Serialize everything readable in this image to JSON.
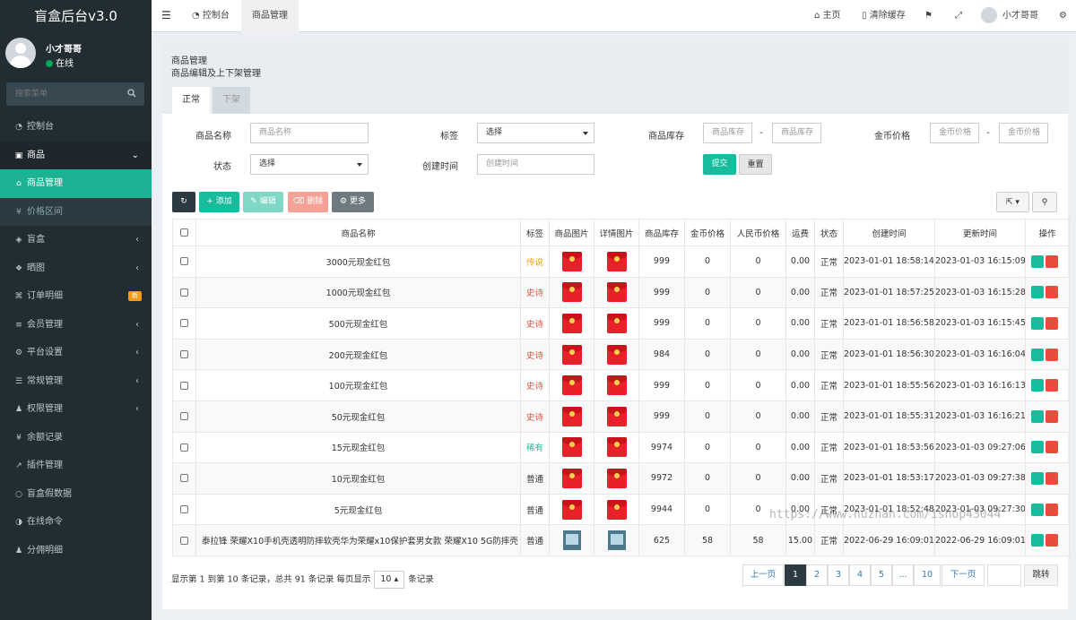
{
  "app": {
    "title": "盲盒后台v3.0"
  },
  "user": {
    "name": "小才哥哥",
    "status": "在线"
  },
  "search": {
    "placeholder": "搜索菜单"
  },
  "menu": [
    {
      "label": "控制台",
      "icon": "dashboard-icon"
    },
    {
      "label": "商品",
      "icon": "shopping-bag-icon"
    },
    {
      "label": "商品管理",
      "icon": "store-icon"
    },
    {
      "label": "价格区间",
      "icon": "yen-icon"
    },
    {
      "label": "盲盒",
      "icon": "cube-icon"
    },
    {
      "label": "晒图",
      "icon": "cubes-icon"
    },
    {
      "label": "订单明细",
      "icon": "cart-icon",
      "badge": "新"
    },
    {
      "label": "会员管理",
      "icon": "list-icon"
    },
    {
      "label": "平台设置",
      "icon": "gear-icon"
    },
    {
      "label": "常规管理",
      "icon": "cog-icon"
    },
    {
      "label": "权限管理",
      "icon": "group-icon"
    },
    {
      "label": "余额记录",
      "icon": "yen-icon"
    },
    {
      "label": "插件管理",
      "icon": "rocket-icon"
    },
    {
      "label": "盲盒假数据",
      "icon": "circle-icon"
    },
    {
      "label": "在线命令",
      "icon": "adjust-icon"
    },
    {
      "label": "分佣明细",
      "icon": "group-icon"
    }
  ],
  "topbar": {
    "tab_dashboard": "控制台",
    "tab_goods": "商品管理",
    "home": "主页",
    "clear_cache": "清除缓存",
    "user": "小才哥哥"
  },
  "page": {
    "title": "商品管理",
    "subtitle": "商品编辑及上下架管理",
    "tab_normal": "正常",
    "tab_off": "下架"
  },
  "filters": {
    "name_label": "商品名称",
    "name_placeholder": "商品名称",
    "tag_label": "标签",
    "tag_value": "选择",
    "stock_label": "商品库存",
    "stock_placeholder": "商品库存",
    "dash": "-",
    "coin_label": "金币价格",
    "coin_placeholder": "金币价格",
    "status_label": "状态",
    "status_value": "选择",
    "created_label": "创建时间",
    "created_placeholder": "创建时间",
    "submit": "提交",
    "reset": "重置"
  },
  "toolbar": {
    "add": "添加",
    "edit": "编辑",
    "delete": "删除",
    "more": "更多"
  },
  "table": {
    "headers": [
      "商品名称",
      "标签",
      "商品图片",
      "详情图片",
      "商品库存",
      "金币价格",
      "人民币价格",
      "运费",
      "状态",
      "创建时间",
      "更新时间",
      "操作"
    ],
    "rows": [
      {
        "name": "3000元现金红包",
        "tag": "传说",
        "tag_color": "#f39c12",
        "img": "red",
        "stock": "999",
        "coin": "0",
        "rmb": "0",
        "ship": "0.00",
        "status": "正常",
        "created": "2023-01-01 18:58:14",
        "updated": "2023-01-03 16:15:09"
      },
      {
        "name": "1000元现金红包",
        "tag": "史诗",
        "tag_color": "#dd4b39",
        "img": "red",
        "stock": "999",
        "coin": "0",
        "rmb": "0",
        "ship": "0.00",
        "status": "正常",
        "created": "2023-01-01 18:57:25",
        "updated": "2023-01-03 16:15:28"
      },
      {
        "name": "500元现金红包",
        "tag": "史诗",
        "tag_color": "#dd4b39",
        "img": "red",
        "stock": "999",
        "coin": "0",
        "rmb": "0",
        "ship": "0.00",
        "status": "正常",
        "created": "2023-01-01 18:56:58",
        "updated": "2023-01-03 16:15:45"
      },
      {
        "name": "200元现金红包",
        "tag": "史诗",
        "tag_color": "#dd4b39",
        "img": "red",
        "stock": "984",
        "coin": "0",
        "rmb": "0",
        "ship": "0.00",
        "status": "正常",
        "created": "2023-01-01 18:56:30",
        "updated": "2023-01-03 16:16:04"
      },
      {
        "name": "100元现金红包",
        "tag": "史诗",
        "tag_color": "#dd4b39",
        "img": "red",
        "stock": "999",
        "coin": "0",
        "rmb": "0",
        "ship": "0.00",
        "status": "正常",
        "created": "2023-01-01 18:55:56",
        "updated": "2023-01-03 16:16:13"
      },
      {
        "name": "50元现金红包",
        "tag": "史诗",
        "tag_color": "#dd4b39",
        "img": "red",
        "stock": "999",
        "coin": "0",
        "rmb": "0",
        "ship": "0.00",
        "status": "正常",
        "created": "2023-01-01 18:55:31",
        "updated": "2023-01-03 16:16:21"
      },
      {
        "name": "15元现金红包",
        "tag": "稀有",
        "tag_color": "#18bc9c",
        "img": "red",
        "stock": "9974",
        "coin": "0",
        "rmb": "0",
        "ship": "0.00",
        "status": "正常",
        "created": "2023-01-01 18:53:56",
        "updated": "2023-01-03 09:27:06"
      },
      {
        "name": "10元现金红包",
        "tag": "普通",
        "tag_color": "#333333",
        "img": "red",
        "stock": "9972",
        "coin": "0",
        "rmb": "0",
        "ship": "0.00",
        "status": "正常",
        "created": "2023-01-01 18:53:17",
        "updated": "2023-01-03 09:27:38"
      },
      {
        "name": "5元现金红包",
        "tag": "普通",
        "tag_color": "#333333",
        "img": "red",
        "stock": "9944",
        "coin": "0",
        "rmb": "0",
        "ship": "0.00",
        "status": "正常",
        "created": "2023-01-01 18:52:48",
        "updated": "2023-01-03 09:27:30"
      },
      {
        "name": "泰拉锋 荣耀X10手机壳透明防摔软壳华为荣耀x10保护套男女款 荣耀X10 5G防摔壳",
        "tag": "普通",
        "tag_color": "#333333",
        "img": "photo",
        "stock": "625",
        "coin": "58",
        "rmb": "58",
        "ship": "15.00",
        "status": "正常",
        "created": "2022-06-29 16:09:01",
        "updated": "2022-06-29 16:09:01"
      }
    ]
  },
  "footer": {
    "prefix": "显示第 1 到第 10 条记录，总共 91 条记录 每页显示",
    "per_page": "10",
    "suffix": "条记录"
  },
  "pagination": {
    "prev": "上一页",
    "pages": [
      "1",
      "2",
      "3",
      "4",
      "5",
      "...",
      "10"
    ],
    "next": "下一页",
    "jump": "跳转"
  },
  "watermark": "https://www.huzhan.com/ishop43044",
  "colors": {
    "sidebar": "#222d32",
    "accent": "#1cb394",
    "dark_btn": "#2c3b41",
    "danger": "#f56954"
  }
}
